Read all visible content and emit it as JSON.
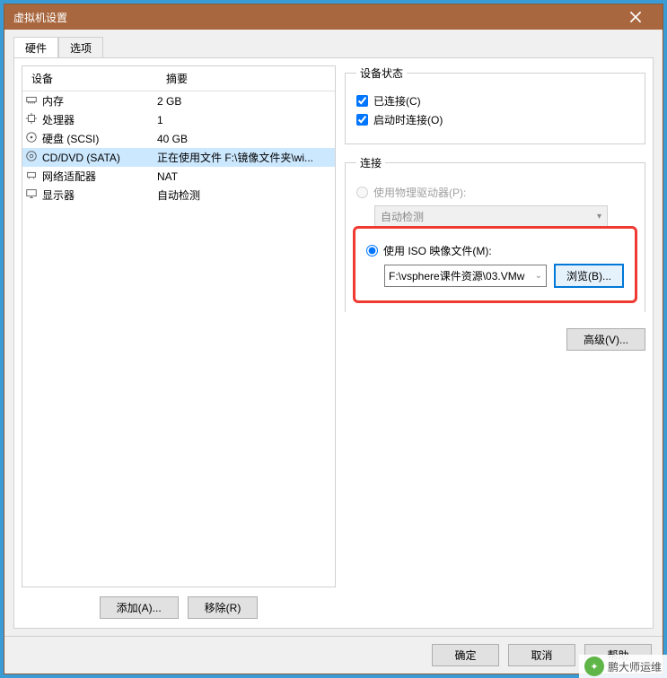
{
  "title": "虚拟机设置",
  "tabs": {
    "hardware": "硬件",
    "options": "选项"
  },
  "list": {
    "header_device": "设备",
    "header_summary": "摘要",
    "rows": [
      {
        "icon": "memory",
        "name": "内存",
        "summary": "2 GB"
      },
      {
        "icon": "cpu",
        "name": "处理器",
        "summary": "1"
      },
      {
        "icon": "disk",
        "name": "硬盘 (SCSI)",
        "summary": "40 GB"
      },
      {
        "icon": "cd",
        "name": "CD/DVD (SATA)",
        "summary": "正在使用文件 F:\\镜像文件夹\\wi..."
      },
      {
        "icon": "net",
        "name": "网络适配器",
        "summary": "NAT"
      },
      {
        "icon": "display",
        "name": "显示器",
        "summary": "自动检测"
      }
    ]
  },
  "buttons": {
    "add": "添加(A)...",
    "remove": "移除(R)",
    "ok": "确定",
    "cancel": "取消",
    "help": "帮助",
    "browse": "浏览(B)...",
    "advanced": "高级(V)..."
  },
  "status": {
    "group": "设备状态",
    "connected": "已连接(C)",
    "connect_on": "启动时连接(O)"
  },
  "connection": {
    "group": "连接",
    "physical": "使用物理驱动器(P):",
    "physical_value": "自动检测",
    "iso": "使用 ISO 映像文件(M):",
    "iso_path": "F:\\vsphere课件资源\\03.VMw"
  },
  "watermark": "鹏大师运维"
}
